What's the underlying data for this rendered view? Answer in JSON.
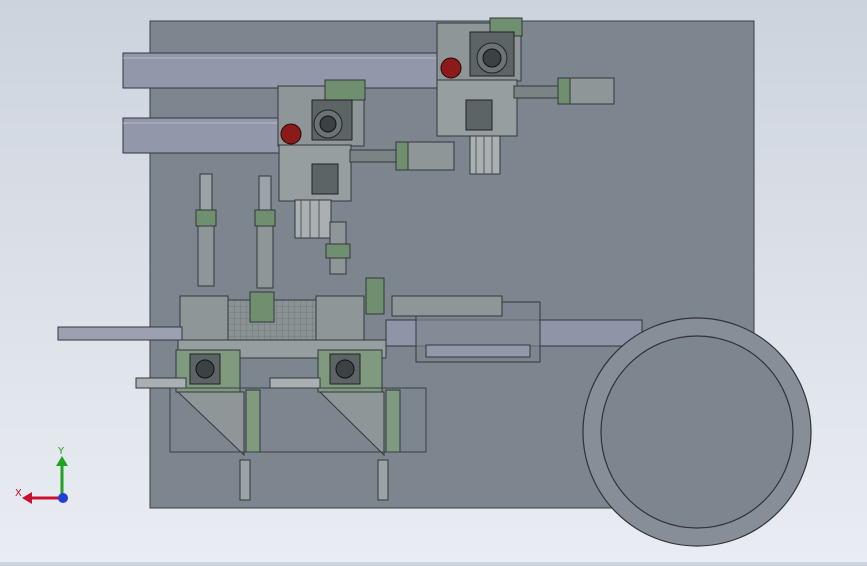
{
  "viewport": {
    "background_top": "#cdd3dd",
    "background_bottom": "#e9ecf2"
  },
  "model": {
    "base_plate_color": "#7d858e",
    "frame_color": "#9aa3ad",
    "part_color": "#8a9293",
    "green_part_color": "#7f9a7f",
    "dark_part_color": "#5d6466",
    "red_knob_color": "#8b1a1a",
    "rail_color": "#9297aa"
  },
  "triad": {
    "x_label": "X",
    "y_label": "Y",
    "x_color": "#c8102e",
    "y_color": "#21a321",
    "z_color": "#1f3fd6"
  }
}
